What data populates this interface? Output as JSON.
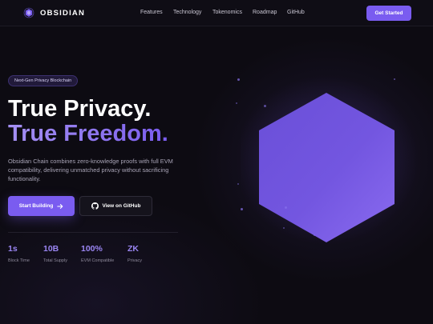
{
  "nav": {
    "brand": "OBSIDIAN",
    "links": [
      "Features",
      "Technology",
      "Tokenomics",
      "Roadmap",
      "GitHub"
    ],
    "cta": "Get Started"
  },
  "hero": {
    "badge": "Next-Gen Privacy Blockchain",
    "title_line1": "True Privacy.",
    "title_line2": "True Freedom.",
    "description": "Obsidian Chain combines zero-knowledge proofs with full EVM compatibility, delivering unmatched privacy without sacrificing functionality.",
    "primary_button": "Start Building",
    "secondary_button": "View on GitHub"
  },
  "stats": [
    {
      "value": "1s",
      "label": "Block Time"
    },
    {
      "value": "10B",
      "label": "Total Supply"
    },
    {
      "value": "100%",
      "label": "EVM Compatible"
    },
    {
      "value": "ZK",
      "label": "Privacy"
    }
  ],
  "icons": {
    "brand": "obsidian-logo-icon",
    "primary_button": "arrow-right-icon",
    "secondary_button": "github-icon",
    "hero_visual": "hexagon-graphic"
  },
  "colors": {
    "background": "#0d0b12",
    "accent": "#7a5cf0",
    "accent_light": "#9a85f2",
    "text_muted": "#a8a4b6"
  }
}
